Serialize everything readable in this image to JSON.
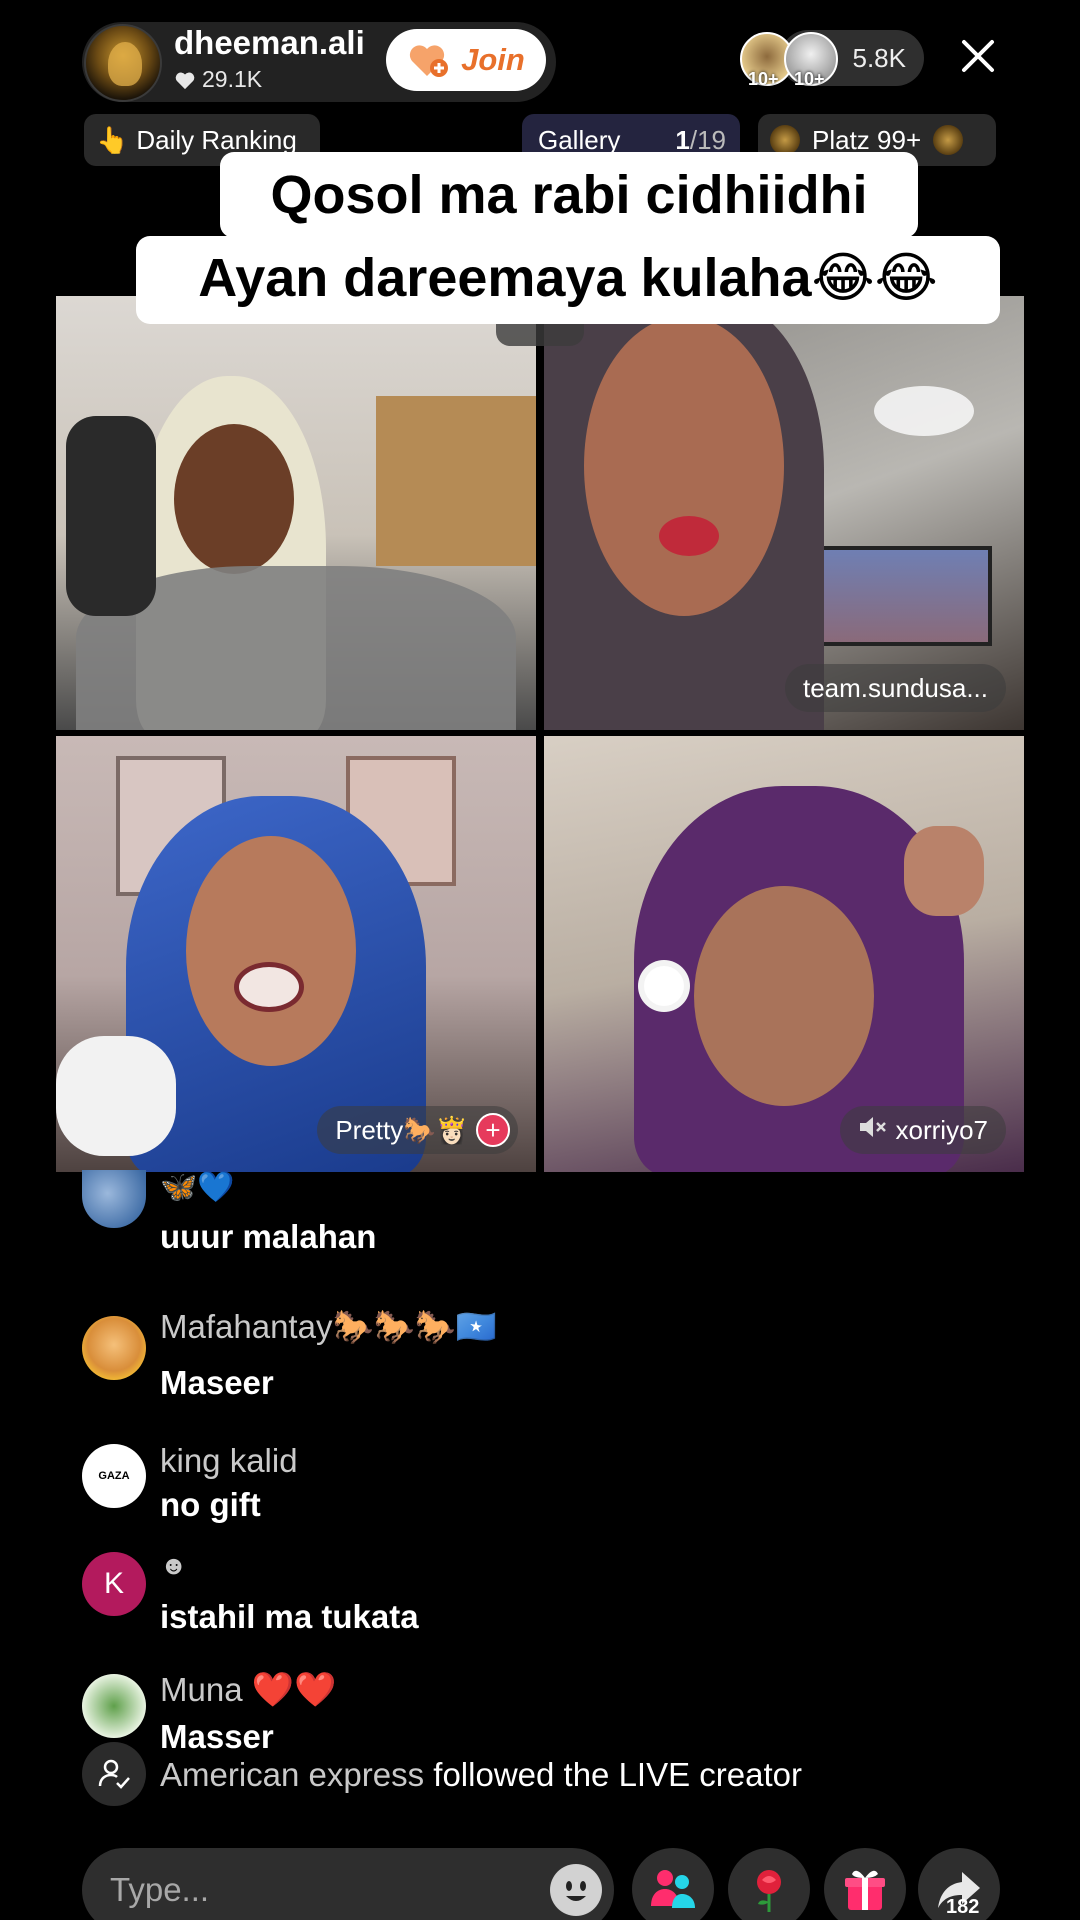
{
  "header": {
    "host_name": "dheeman.ali",
    "host_likes": "29.1K",
    "join_label": "Join",
    "viewer_badges": [
      "10+",
      "10+"
    ],
    "viewer_count": "5.8K"
  },
  "subheader": {
    "ranking_label": "Daily Ranking",
    "ranking_icon": "👆",
    "gallery_label": "Gallery",
    "gallery_current": "1",
    "gallery_total": "/19",
    "platz_label": "Platz 99+"
  },
  "caption": {
    "line1": "Qosol ma rabi cidhiidhi",
    "line2": "Ayan dareemaya kulaha😂😂"
  },
  "tiles": [
    {
      "label": ""
    },
    {
      "label": "team.sundusa..."
    },
    {
      "label": "Pretty🐎👸🏻"
    },
    {
      "label": "xorriyo7"
    }
  ],
  "comments": [
    {
      "user": "🦋💙",
      "text": "uuur malahan"
    },
    {
      "user": "Mafahantay🐎🐎🐎🇸🇴",
      "text": "Maseer"
    },
    {
      "user": "king kalid",
      "avatar_text": "GAZA",
      "text": "no gift"
    },
    {
      "user": "☻",
      "avatar_letter": "K",
      "text": "istahil ma tukata"
    },
    {
      "user": "Muna",
      "user_extra": "❤️❤️",
      "text": "Masser"
    }
  ],
  "follow_event": {
    "name": "American express",
    "action": "followed the LIVE creator"
  },
  "bottom_bar": {
    "input_placeholder": "Type...",
    "share_count": "182"
  },
  "colors": {
    "join_text": "#e8702b",
    "gift_pink": "#ff2d6d",
    "gift_cyan": "#25d5e8",
    "comment_username": "#c9c9c9"
  }
}
